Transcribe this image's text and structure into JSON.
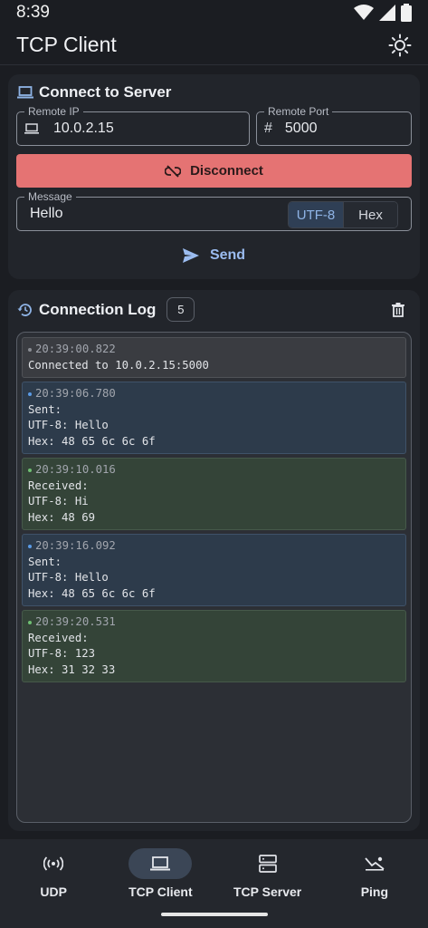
{
  "status": {
    "time": "8:39"
  },
  "app": {
    "title": "TCP Client"
  },
  "connect": {
    "title": "Connect to Server",
    "remote_ip_label": "Remote IP",
    "remote_ip_value": "10.0.2.15",
    "remote_port_label": "Remote Port",
    "remote_port_value": "5000",
    "disconnect_label": "Disconnect",
    "message_label": "Message",
    "message_value": "Hello",
    "encoding_options": [
      "UTF-8",
      "Hex"
    ],
    "encoding_selected": "UTF-8",
    "send_label": "Send"
  },
  "log": {
    "title": "Connection Log",
    "count": "5",
    "entries": [
      {
        "type": "info",
        "time": "20:39:00.822",
        "lines": [
          "Connected to 10.0.2.15:5000"
        ]
      },
      {
        "type": "sent",
        "time": "20:39:06.780",
        "lines": [
          "Sent:",
          "UTF-8: Hello",
          "Hex: 48 65 6c 6c 6f"
        ]
      },
      {
        "type": "received",
        "time": "20:39:10.016",
        "lines": [
          "Received:",
          "UTF-8: Hi",
          "Hex: 48 69"
        ]
      },
      {
        "type": "sent",
        "time": "20:39:16.092",
        "lines": [
          "Sent:",
          "UTF-8: Hello",
          "Hex: 48 65 6c 6c 6f"
        ]
      },
      {
        "type": "received",
        "time": "20:39:20.531",
        "lines": [
          "Received:",
          "UTF-8: 123",
          "Hex: 31 32 33"
        ]
      }
    ]
  },
  "nav": {
    "items": [
      {
        "label": "UDP",
        "icon": "broadcast-icon",
        "active": false
      },
      {
        "label": "TCP Client",
        "icon": "laptop-icon",
        "active": true
      },
      {
        "label": "TCP Server",
        "icon": "server-icon",
        "active": false
      },
      {
        "label": "Ping",
        "icon": "ping-icon",
        "active": false
      }
    ]
  },
  "colors": {
    "accent": "#9bbcf0",
    "disconnect": "#e57373",
    "sent_dot": "#5b9be6",
    "received_dot": "#6fbf73"
  }
}
